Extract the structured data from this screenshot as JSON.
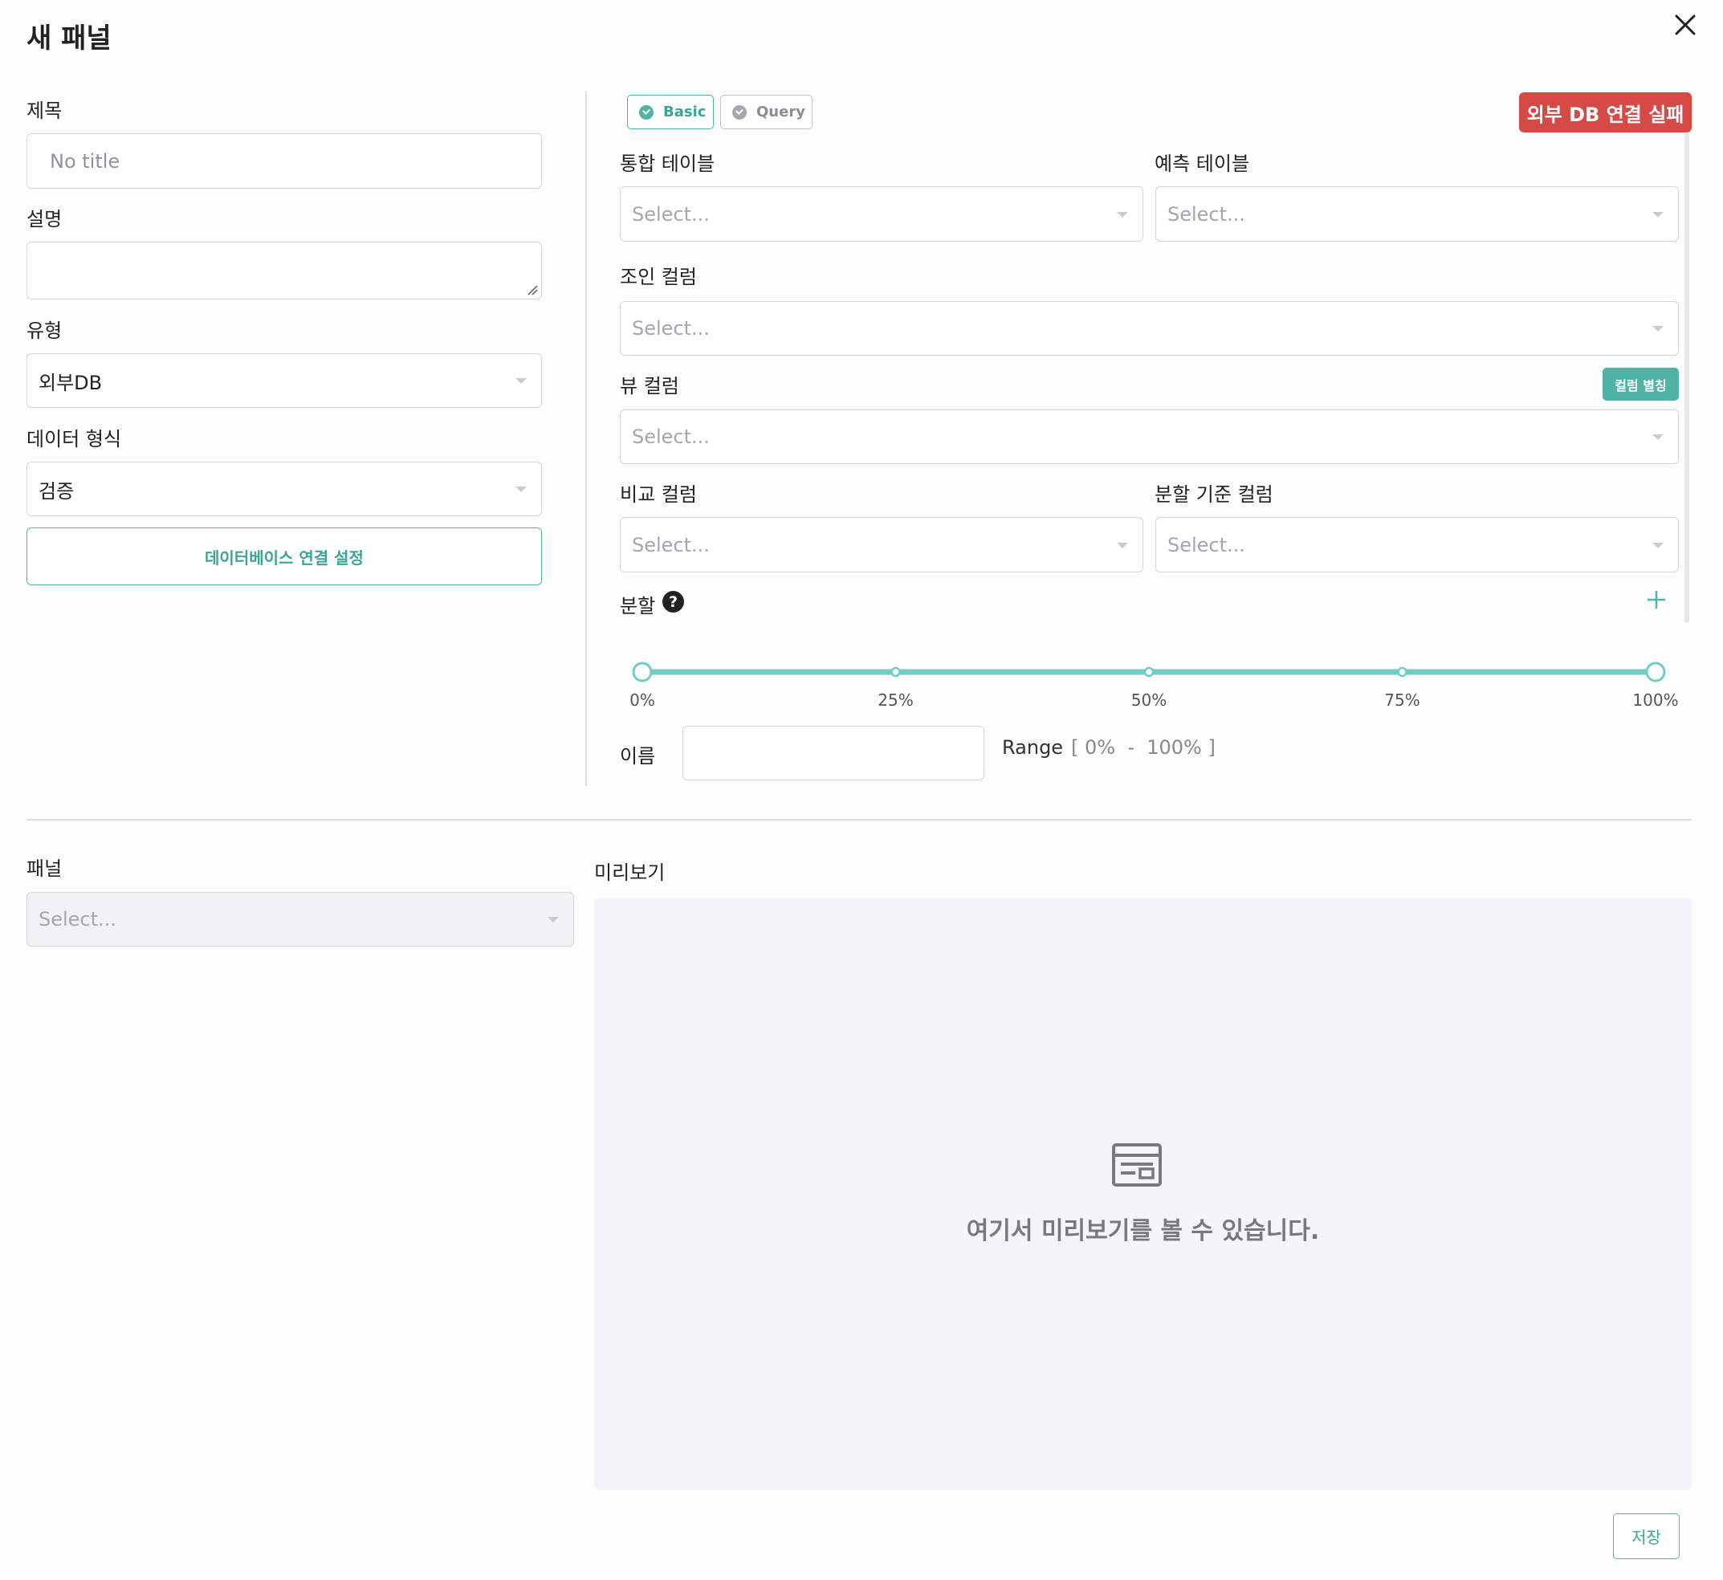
{
  "dialog": {
    "title": "새 패널"
  },
  "left_form": {
    "title_label": "제목",
    "title_placeholder": "No title",
    "description_label": "설명",
    "type_label": "유형",
    "type_value": "외부DB",
    "data_format_label": "데이터 형식",
    "data_format_value": "검증",
    "db_connection_button": "데이터베이스 연결 설정"
  },
  "mode_tabs": [
    {
      "label": "Basic",
      "active": true
    },
    {
      "label": "Query",
      "active": false
    }
  ],
  "connection_status": {
    "text": "외부 DB 연결 실패",
    "color": "#d64a45"
  },
  "right_form": {
    "integrated_table_label": "통합 테이블",
    "integrated_table_placeholder": "Select...",
    "prediction_table_label": "예측 테이블",
    "prediction_table_placeholder": "Select...",
    "join_column_label": "조인 컬럼",
    "join_column_placeholder": "Select...",
    "view_column_label": "뷰 컬럼",
    "view_column_placeholder": "Select...",
    "column_alias_button": "컬럼 별칭",
    "compare_column_label": "비교 컬럼",
    "compare_column_placeholder": "Select...",
    "split_basis_column_label": "분할 기준 컬럼",
    "split_basis_column_placeholder": "Select...",
    "split_label": "분할",
    "split_help_icon": "question-circle-icon",
    "add_split_icon": "plus-icon"
  },
  "split_slider": {
    "ticks": [
      "0%",
      "25%",
      "50%",
      "75%",
      "100%"
    ],
    "range_start": 0,
    "range_end": 100,
    "track_color": "#6fcdc3"
  },
  "split_item": {
    "name_label": "이름",
    "name_value": "",
    "range_label": "Range",
    "range_value": "[ 0%  -  100% ]"
  },
  "panel": {
    "label": "패널",
    "placeholder": "Select..."
  },
  "preview": {
    "label": "미리보기",
    "empty_text": "여기서 미리보기를 볼 수 있습니다.",
    "icon": "layout-icon"
  },
  "footer": {
    "save_label": "저장"
  },
  "colors": {
    "accent": "#4fb3a6",
    "danger": "#d64a45"
  }
}
